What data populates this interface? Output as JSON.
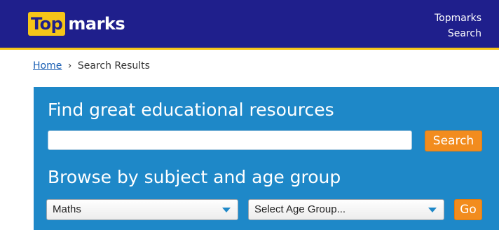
{
  "header": {
    "logo_top": "Top",
    "logo_marks": "marks",
    "search_link": "Topmarks Search",
    "colors": {
      "background": "#1f1f8c",
      "accent": "#f5c518"
    }
  },
  "breadcrumb": {
    "home": "Home",
    "separator": "›",
    "current": "Search Results"
  },
  "search_panel": {
    "heading": "Find great educational resources",
    "search_input_value": "",
    "search_button": "Search",
    "browse_heading": "Browse by subject and age group",
    "subject_select": "Maths",
    "age_select": "Select Age Group...",
    "go_button": "Go",
    "colors": {
      "panel": "#1e88c8",
      "button": "#f28c1e"
    }
  }
}
